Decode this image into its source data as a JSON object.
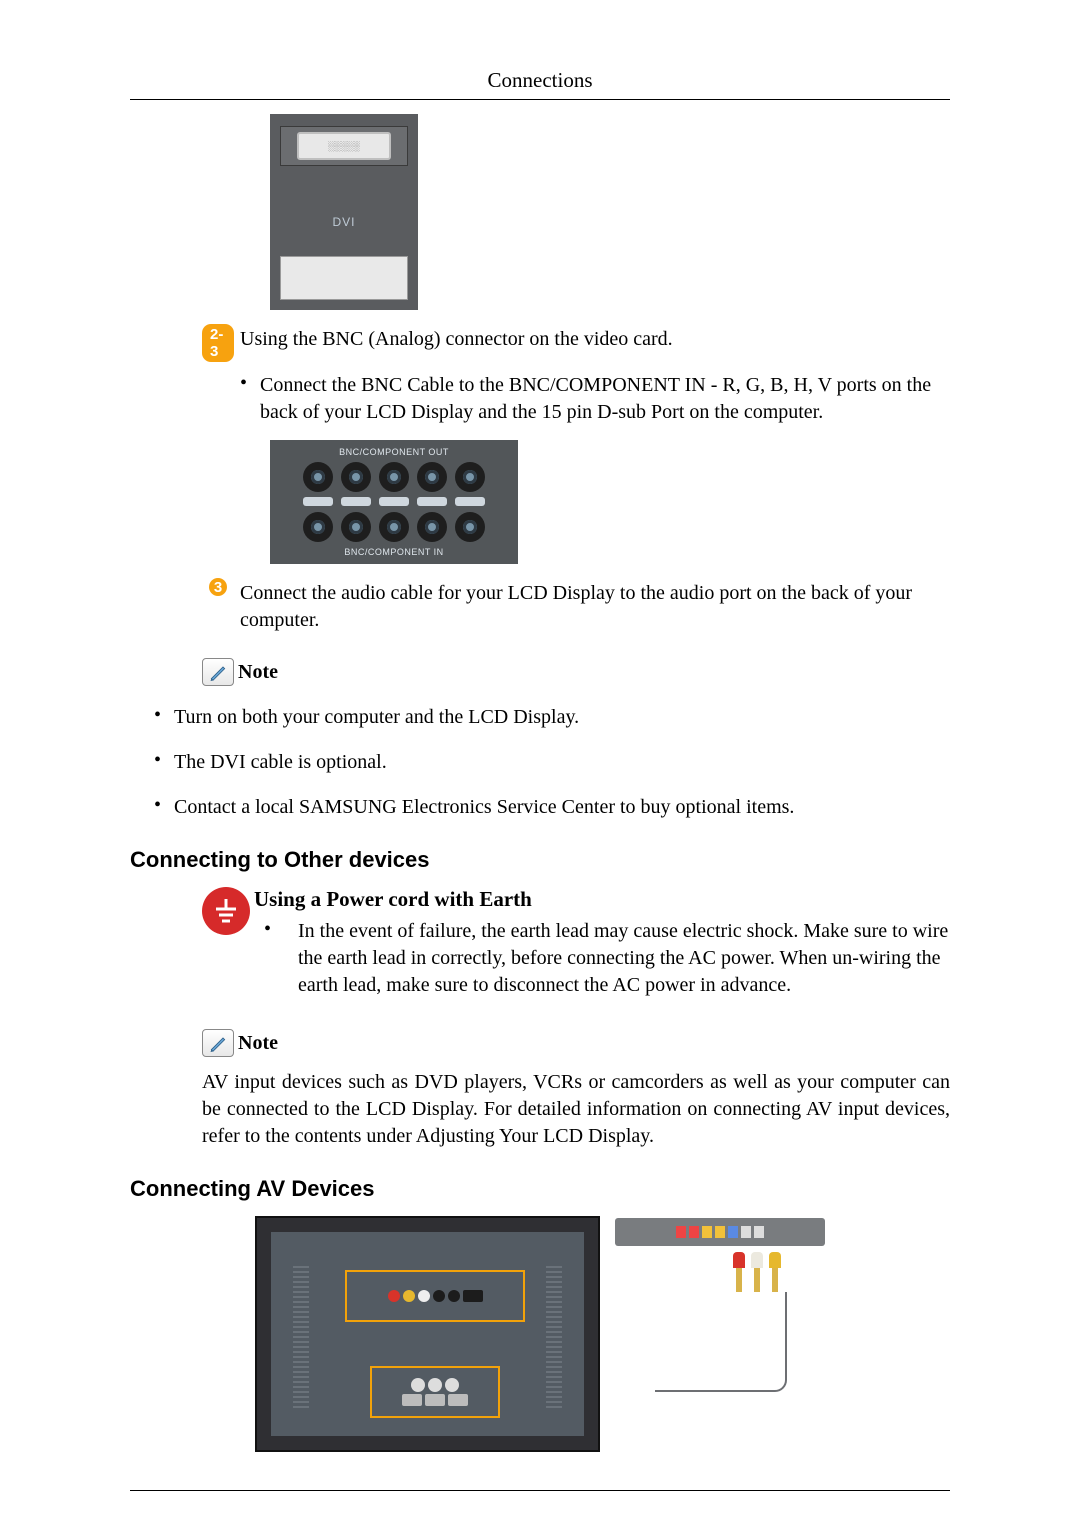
{
  "header": {
    "title": "Connections"
  },
  "figure_dvi": {
    "label": "DVI"
  },
  "step_2_3": {
    "marker": "2-3",
    "text": "Using the BNC (Analog) connector on the video card."
  },
  "step_2_3_bullet": "Connect the BNC Cable to the BNC/COMPONENT IN - R, G, B, H, V ports on the back of your LCD Display and the 15 pin D-sub Port on the computer.",
  "figure_bnc": {
    "top_label": "BNC/COMPONENT OUT",
    "bottom_label": "BNC/COMPONENT IN"
  },
  "step_3": {
    "marker": "3",
    "text": "Connect the audio cable for your LCD Display to the audio port on the back of your computer."
  },
  "note1": {
    "label": "Note",
    "items": [
      "Turn on both your computer and the LCD Display.",
      "The DVI cable is optional.",
      "Contact a local SAMSUNG Electronics Service Center to buy optional items."
    ]
  },
  "section_other": {
    "heading": "Connecting to Other devices",
    "sub_heading": "Using a Power cord with Earth",
    "bullet": "In the event of failure, the earth lead may cause electric shock. Make sure to wire the earth lead in correctly, before connecting the AC power. When un-wiring the earth lead, make sure to disconnect the AC power in advance."
  },
  "note2": {
    "label": "Note",
    "text": "AV input devices such as DVD players, VCRs or camcorders as well as your computer can be connected to the LCD Display. For detailed information on connecting AV input devices, refer to the contents under Adjusting Your LCD Display."
  },
  "section_av": {
    "heading": "Connecting AV Devices"
  }
}
